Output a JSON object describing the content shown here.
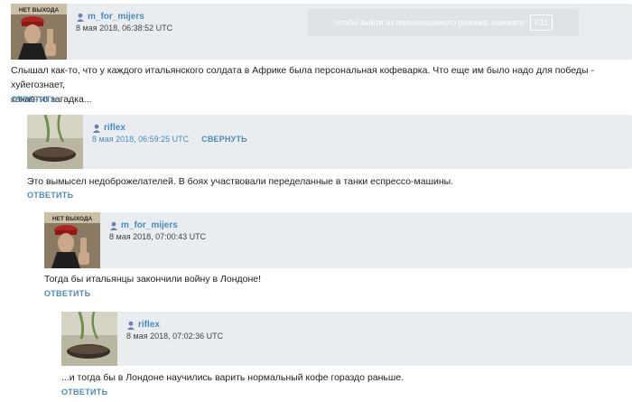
{
  "fullscreen_hint": {
    "text": "Чтобы выйти из полноэкранного режима, нажмите",
    "key": "F11"
  },
  "comments": [
    {
      "author": "m_for_mijers",
      "date": "8 мая 2018, 06:38:52 UTC",
      "avatar_caption": "НЕТ ВЫХОДА",
      "text_line1": "Слышал как-то, что у каждого итальянского солдата в Африке была персональная кофеварка. Что еще им было надо для победы - хуйегознает,",
      "text_line2": "какая-то загадка...",
      "reply": "ОТВЕТИТЬ"
    },
    {
      "author": "riflex",
      "date": "8 мая 2018, 06:59:25 UTC",
      "collapse": "СВЕРНУТЬ",
      "text": "Это вымысел недоброжелателей. В боях участвовали переделанные в танки еспрессо-машины.",
      "reply": "ОТВЕТИТЬ"
    },
    {
      "author": "m_for_mijers",
      "date": "8 мая 2018, 07:00:43 UTC",
      "avatar_caption": "НЕТ ВЫХОДА",
      "text": "Тогда бы итальянцы закончили войну в Лондоне!",
      "reply": "ОТВЕТИТЬ"
    },
    {
      "author": "riflex",
      "date": "8 мая 2018, 07:02:36 UTC",
      "text": "...и тогда бы в Лондоне научились варить нормальный кофе гораздо раньше.",
      "reply": "ОТВЕТИТЬ"
    }
  ],
  "icons": {
    "user": "user-icon"
  }
}
